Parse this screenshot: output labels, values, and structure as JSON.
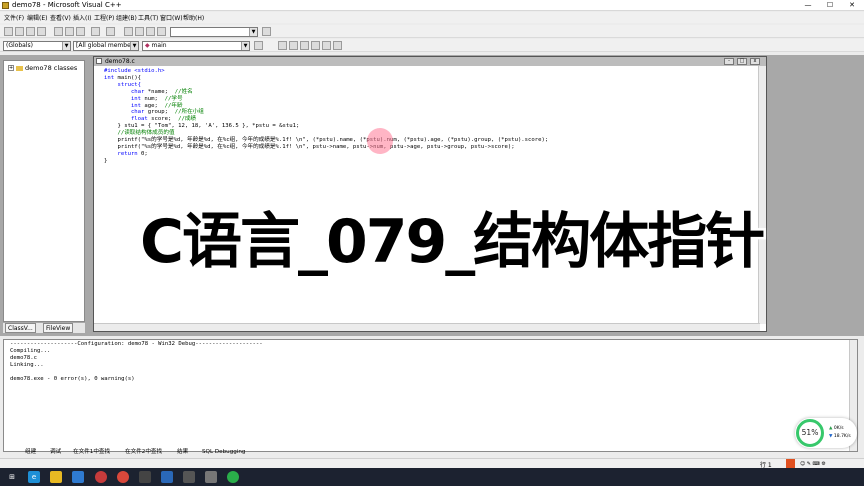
{
  "window": {
    "title": "demo78 - Microsoft Visual C++"
  },
  "window_controls": {
    "minimize": "—",
    "maximize": "☐",
    "close": "✕"
  },
  "menu": [
    "文件(F)",
    "编辑(E)",
    "查看(V)",
    "插入(I)",
    "工程(P)",
    "组建(B)",
    "工具(T)",
    "窗口(W)",
    "帮助(H)"
  ],
  "toolbar": {
    "scope_combo": "(Globals)",
    "members_combo": "[All global members",
    "function_combo": "main"
  },
  "classview": {
    "root": "demo78 classes",
    "expander": "+",
    "tabs": [
      "ClassV...",
      "FileView"
    ]
  },
  "editor": {
    "doc_title": "demo78.c",
    "doc_controls": [
      "-",
      "□",
      "x"
    ],
    "lines": [
      [
        {
          "t": "#include <stdio.h>",
          "c": "kw"
        }
      ],
      [
        {
          "t": "int",
          "c": "kw"
        },
        {
          "t": " main(){",
          "c": ""
        }
      ],
      [
        {
          "t": "    struct{",
          "c": "kw"
        }
      ],
      [
        {
          "t": "        char",
          "c": "kw"
        },
        {
          "t": " *name;  ",
          "c": ""
        },
        {
          "t": "//姓名",
          "c": "cm"
        }
      ],
      [
        {
          "t": "        int",
          "c": "kw"
        },
        {
          "t": " num;  ",
          "c": ""
        },
        {
          "t": "//学号",
          "c": "cm"
        }
      ],
      [
        {
          "t": "        int",
          "c": "kw"
        },
        {
          "t": " age;  ",
          "c": ""
        },
        {
          "t": "//年龄",
          "c": "cm"
        }
      ],
      [
        {
          "t": "        char",
          "c": "kw"
        },
        {
          "t": " group;  ",
          "c": ""
        },
        {
          "t": "//所在小组",
          "c": "cm"
        }
      ],
      [
        {
          "t": "        float",
          "c": "kw"
        },
        {
          "t": " score;  ",
          "c": ""
        },
        {
          "t": "//成绩",
          "c": "cm"
        }
      ],
      [
        {
          "t": "    } stu1 = { \"Tom\", 12, 18, 'A', 136.5 }, *pstu = &stu1;",
          "c": ""
        }
      ],
      [
        {
          "t": "    //读取结构体成员的值",
          "c": "cm"
        }
      ],
      [
        {
          "t": "    printf(\"%s的学号是%d, 年龄是%d, 在%c组, 今年的成绩是%.1f! \\n\", (*pstu).name, (*pstu).num, (*pstu).age, (*pstu).group, (*pstu).score);",
          "c": ""
        }
      ],
      [
        {
          "t": "    printf(\"%s的学号是%d, 年龄是%d, 在%c组, 今年的成绩是%.1f! \\n\", pstu->name, pstu->num, pstu->age, pstu->group, pstu->score);",
          "c": ""
        }
      ],
      [
        {
          "t": "    return",
          "c": "kw"
        },
        {
          "t": " 0;",
          "c": ""
        }
      ],
      [
        {
          "t": "}",
          "c": ""
        }
      ]
    ]
  },
  "caption": "C语言_079_结构体指针",
  "output": {
    "lines": [
      "--------------------Configuration: demo78 - Win32 Debug--------------------",
      "Compiling...",
      "demo78.c",
      "Linking...",
      "",
      "demo78.exe - 0 error(s), 0 warning(s)"
    ],
    "tabs": [
      "组建",
      "调试",
      "在文件1中查找",
      "在文件2中查找",
      "结果",
      "SQL Debugging"
    ]
  },
  "speed_meter": {
    "percent": "51%",
    "up": "0K/s",
    "down": "18.7K/s"
  },
  "statusbar": {
    "text": "行 1"
  },
  "colors": {
    "keyword": "#0000ff",
    "comment": "#008000",
    "meter_ring": "#37c86b",
    "taskbar": "#1c2230"
  }
}
